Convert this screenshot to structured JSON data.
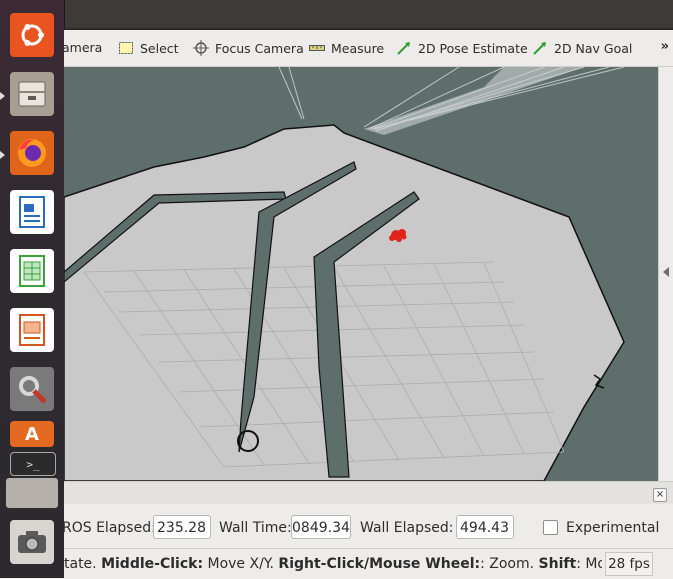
{
  "toolbar": {
    "tools": [
      {
        "name": "interact-camera",
        "label": "amera",
        "icon": "camera-icon"
      },
      {
        "name": "select",
        "label": "Select",
        "icon": "select-box-icon"
      },
      {
        "name": "focus-camera",
        "label": "Focus Camera",
        "icon": "crosshair-icon"
      },
      {
        "name": "measure",
        "label": "Measure",
        "icon": "ruler-icon"
      },
      {
        "name": "2d-pose-estimate",
        "label": "2D Pose Estimate",
        "icon": "green-arrow-icon"
      },
      {
        "name": "2d-nav-goal",
        "label": "2D Nav Goal",
        "icon": "green-arrow-icon"
      }
    ],
    "overflow": "»"
  },
  "launcher": {
    "items": [
      "ubuntu-dash-icon",
      "files-icon",
      "firefox-icon",
      "writer-icon",
      "calc-icon",
      "impress-icon",
      "settings-icon",
      "software-store-icon",
      "terminal-icon",
      "camera-icon"
    ]
  },
  "time": {
    "ros_elapsed_label": "ROS Elapsed:",
    "ros_elapsed_value": "235.28",
    "wall_time_label": "Wall Time:",
    "wall_time_value": "0849.34",
    "wall_elapsed_label": "Wall Elapsed:",
    "wall_elapsed_value": "494.43",
    "experimental_label": "Experimental",
    "experimental_checked": false
  },
  "status": {
    "hint_prefix": "tate. ",
    "hint_mid_bold": "Middle-Click:",
    "hint_mid": " Move X/Y. ",
    "hint_right_bold": "Right-Click/Mouse Wheel:",
    "hint_right": ": Zoom. ",
    "hint_shift_bold": "Shift",
    "hint_shift": ": More op",
    "fps": "28 fps"
  },
  "colors": {
    "map_background": "#5e6e6b",
    "map_free": "#c9c9c9",
    "map_wall": "#5e6e6b",
    "robot": "#e0241b",
    "grid": "#a8a8a8"
  }
}
